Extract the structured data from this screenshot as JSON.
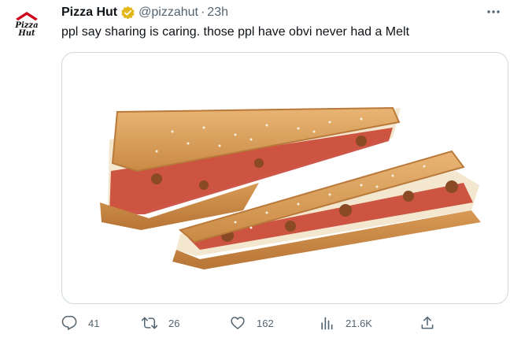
{
  "tweet": {
    "display_name": "Pizza Hut",
    "handle": "@pizzahut",
    "separator": "·",
    "time": "23h",
    "text": "ppl say sharing is caring. those ppl have obvi never had a Melt",
    "avatar_logo_text": "Pizza Hut",
    "verified_color": "#e2b719",
    "media_alt": "Pizza Hut Melt folded pizza sandwich"
  },
  "actions": {
    "replies": "41",
    "retweets": "26",
    "likes": "162",
    "views": "21.6K"
  },
  "icons": {
    "reply": "reply-icon",
    "retweet": "retweet-icon",
    "like": "heart-icon",
    "views": "views-icon",
    "share": "share-icon",
    "more": "more-icon",
    "verified": "verified-badge-icon"
  },
  "colors": {
    "text_primary": "#0f1419",
    "text_secondary": "#536471",
    "border": "#cfd9de",
    "brand_red": "#d0021b"
  }
}
